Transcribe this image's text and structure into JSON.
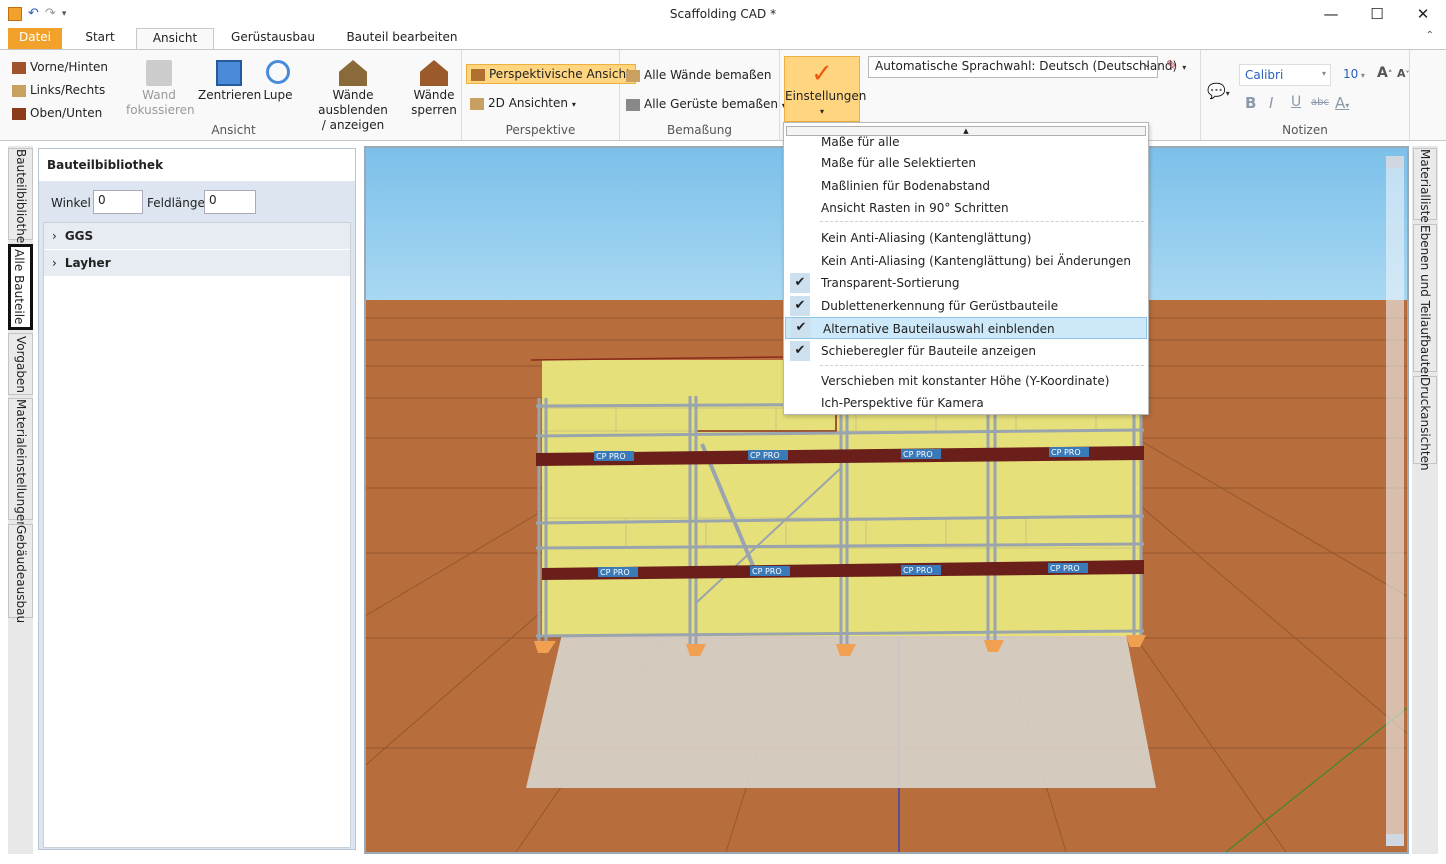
{
  "window": {
    "title": "Scaffolding CAD *",
    "minimize": "—",
    "maximize": "☐",
    "close": "✕"
  },
  "ribbon_tabs": [
    "Datei",
    "Start",
    "Ansicht",
    "Gerüstausbau",
    "Bauteil bearbeiten"
  ],
  "ribbon": {
    "ansicht": {
      "vorne_hinten": "Vorne/Hinten",
      "links_rechts": "Links/Rechts",
      "oben_unten": "Oben/Unten",
      "wand_fokussieren_1": "Wand",
      "wand_fokussieren_2": "fokussieren",
      "zentrieren": "Zentrieren",
      "lupe": "Lupe",
      "waende_ausblenden_1": "Wände ausblenden",
      "waende_ausblenden_2": "/ anzeigen",
      "waende_sperren_1": "Wände",
      "waende_sperren_2": "sperren",
      "group_label": "Ansicht"
    },
    "perspektive": {
      "perspektivische_ansicht": "Perspektivische Ansicht",
      "ansichten_2d": "2D Ansichten",
      "group_label": "Perspektive"
    },
    "bemassung": {
      "alle_waende": "Alle Wände bemaßen",
      "alle_gerueste": "Alle Gerüste bemaßen",
      "group_label": "Bemaßung"
    },
    "einstellungen": {
      "label": "Einstellungen"
    },
    "language": "Automatische Sprachwahl: Deutsch (Deutschland)",
    "notizen": {
      "font": "Calibri",
      "size": "10",
      "group_label": "Notizen"
    }
  },
  "left_tabs": [
    "Bauteilbibliothek",
    "Alle Bauteile",
    "Vorgaben",
    "Materialeinstellungen",
    "Gebäudeausbau"
  ],
  "right_tabs": [
    "Materialliste",
    "Ebenen und Teilaufbauten",
    "Druckansichten"
  ],
  "panel": {
    "title": "Bauteilbibliothek",
    "winkel_label": "Winkel",
    "winkel_value": "0",
    "feldlaenge_label": "Feldlänge",
    "feldlaenge_value": "0",
    "tree": [
      "GGS",
      "Layher"
    ]
  },
  "menu": {
    "items": [
      {
        "label": "Maße für alle",
        "checked": false
      },
      {
        "label": "Maße für alle Selektierten",
        "checked": false
      },
      {
        "label": "Maßlinien für Bodenabstand",
        "checked": false
      },
      {
        "label": "Ansicht Rasten in 90° Schritten",
        "checked": false
      },
      {
        "label": "Kein Anti-Aliasing (Kantenglättung)",
        "checked": false
      },
      {
        "label": "Kein Anti-Aliasing (Kantenglättung) bei Änderungen",
        "checked": false
      },
      {
        "label": "Transparent-Sortierung",
        "checked": true
      },
      {
        "label": "Dublettenerkennung für Gerüstbauteile",
        "checked": true
      },
      {
        "label": "Alternative Bauteilauswahl einblenden",
        "checked": true
      },
      {
        "label": "Schieberegler für Bauteile anzeigen",
        "checked": true
      },
      {
        "label": "Verschieben mit konstanter Höhe (Y-Koordinate)",
        "checked": false
      },
      {
        "label": "Ich-Perspektive für Kamera",
        "checked": false
      }
    ]
  },
  "scaffold_brand": "CP PRO",
  "colors": {
    "accent": "#f2a22a",
    "sky": "#87c8ea",
    "floor": "#b86e3c",
    "wall": "#e6e07a",
    "deck": "#6b1f1a"
  }
}
